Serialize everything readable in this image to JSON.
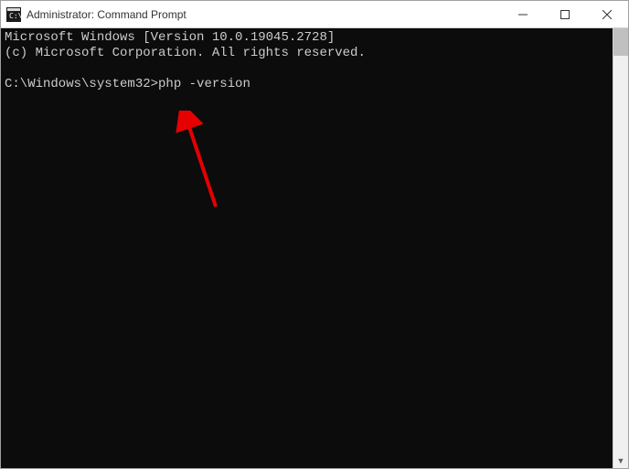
{
  "window": {
    "title": "Administrator: Command Prompt"
  },
  "terminal": {
    "line1": "Microsoft Windows [Version 10.0.19045.2728]",
    "line2": "(c) Microsoft Corporation. All rights reserved.",
    "blank": "",
    "prompt": "C:\\Windows\\system32>",
    "command": "php -version"
  },
  "annotation": {
    "arrow_color": "#e60000"
  }
}
